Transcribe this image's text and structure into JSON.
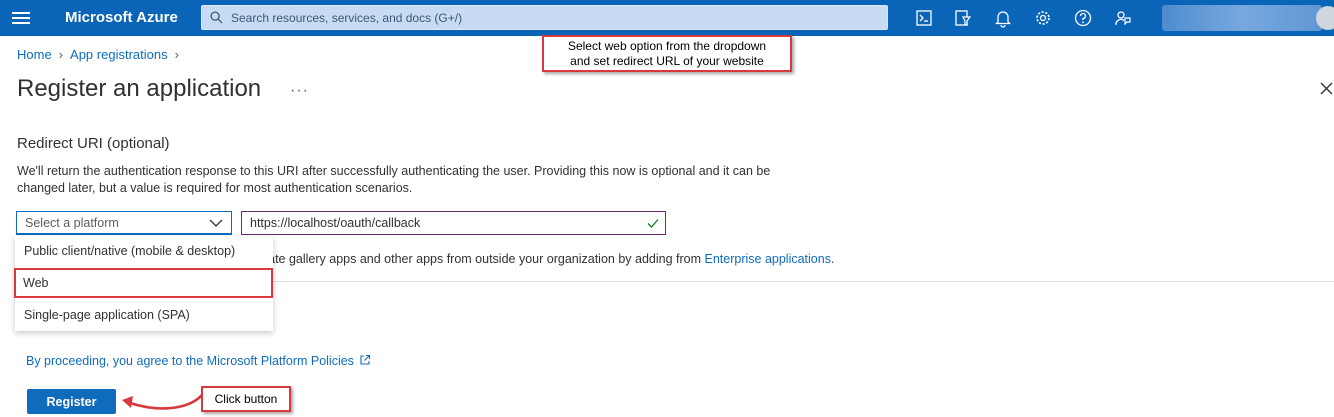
{
  "topbar": {
    "brand": "Microsoft Azure",
    "search_placeholder": "Search resources, services, and docs (G+/)",
    "icons": [
      "cloud-shell-icon",
      "directory-filter-icon",
      "bell-icon",
      "gear-icon",
      "help-icon",
      "feedback-icon"
    ]
  },
  "breadcrumb": {
    "items": [
      "Home",
      "App registrations"
    ]
  },
  "page": {
    "title": "Register an application",
    "more": "···"
  },
  "annotations": {
    "top": [
      "Select web option from the dropdown",
      "and set redirect URL of your website"
    ],
    "button": "Click button"
  },
  "redirect": {
    "heading": "Redirect URI (optional)",
    "description_1": "We'll return the authentication response to this URI after successfully authenticating the user. Providing this now is optional and it can be",
    "description_2": "changed later, but a value is required for most authentication scenarios.",
    "platform_placeholder": "Select a platform",
    "uri_value": "https://localhost/oauth/callback"
  },
  "dropdown": {
    "options": [
      "Public client/native (mobile & desktop)",
      "Web",
      "Single-page application (SPA)"
    ]
  },
  "gallery": {
    "text": "grate gallery apps and other apps from outside your organization by adding from ",
    "link": "Enterprise applications",
    "suffix": "."
  },
  "footer": {
    "policy": "By proceeding, you agree to the Microsoft Platform Policies",
    "register": "Register"
  },
  "colors": {
    "topbar": "#0a64b8",
    "link": "#0f6cbd",
    "annotation": "#d9383c"
  }
}
